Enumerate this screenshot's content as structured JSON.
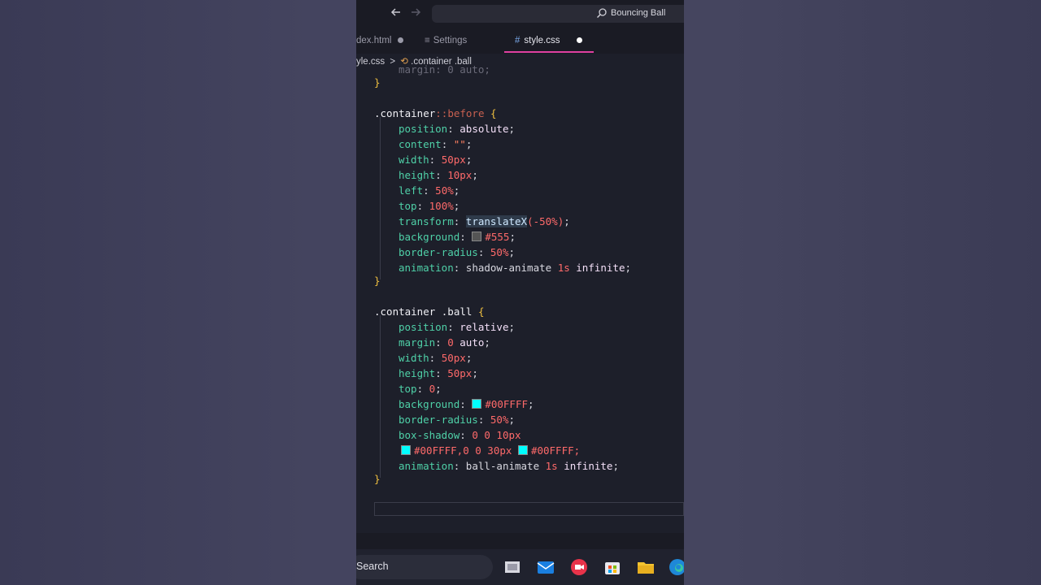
{
  "titlebar": {
    "back_icon": "arrow-left-icon",
    "forward_icon": "arrow-right-icon",
    "search_icon": "search-icon",
    "title": "Bouncing Ball"
  },
  "tabs": [
    {
      "label": "dex.html",
      "modified": true
    },
    {
      "label": "Settings",
      "icon": "settings-icon"
    },
    {
      "label": "style.css",
      "icon": "hash-icon",
      "modified": true,
      "active": true
    }
  ],
  "breadcrumb": {
    "file": "yle.css",
    "separator": ">",
    "symbol_icon": "css-selector-icon",
    "symbol": ".container .ball"
  },
  "code": {
    "top_partial": "margin: 0 auto;",
    "close_brace": "}",
    "block1": {
      "selector": ".container",
      "pseudo": "::before",
      "open": " {",
      "lines": [
        {
          "prop": "position",
          "value": "absolute"
        },
        {
          "prop": "content",
          "value": "\"\""
        },
        {
          "prop": "width",
          "value": "50px"
        },
        {
          "prop": "height",
          "value": "10px"
        },
        {
          "prop": "left",
          "value": "50%"
        },
        {
          "prop": "top",
          "value": "100%"
        },
        {
          "prop": "transform",
          "fn": "translateX",
          "arg": "(-50%)"
        },
        {
          "prop": "background",
          "swatch": "#555555",
          "value": "#555"
        },
        {
          "prop": "border-radius",
          "value": "50%"
        },
        {
          "prop": "animation",
          "value": "shadow-animate",
          "num": "1s",
          "extra": "infinite"
        }
      ]
    },
    "block2": {
      "selector": ".container .ball",
      "open": " {",
      "lines": [
        {
          "prop": "position",
          "value": "relative"
        },
        {
          "prop": "margin",
          "num": "0",
          "value": "auto"
        },
        {
          "prop": "width",
          "value": "50px"
        },
        {
          "prop": "height",
          "value": "50px"
        },
        {
          "prop": "top",
          "value": "0"
        },
        {
          "prop": "background",
          "swatch": "#00FFFF",
          "value": "#00FFFF"
        },
        {
          "prop": "border-radius",
          "value": "50%"
        },
        {
          "prop": "box-shadow",
          "value": "0 0 10px"
        },
        {
          "cont1": "#00FFFF,0 0 30px",
          "cont2": "#00FFFF;"
        },
        {
          "prop": "animation",
          "value": "ball-animate",
          "num": "1s",
          "extra": "infinite"
        }
      ]
    }
  },
  "taskbar": {
    "search_label": "Search",
    "icons": [
      "task-view-icon",
      "mail-icon",
      "camera-icon",
      "store-icon",
      "file-explorer-icon",
      "edge-icon"
    ]
  },
  "colors": {
    "tab_active_underline": "#e040a0",
    "property": "#4fd1a8",
    "number": "#ff6a6a",
    "brace": "#f0c040"
  }
}
